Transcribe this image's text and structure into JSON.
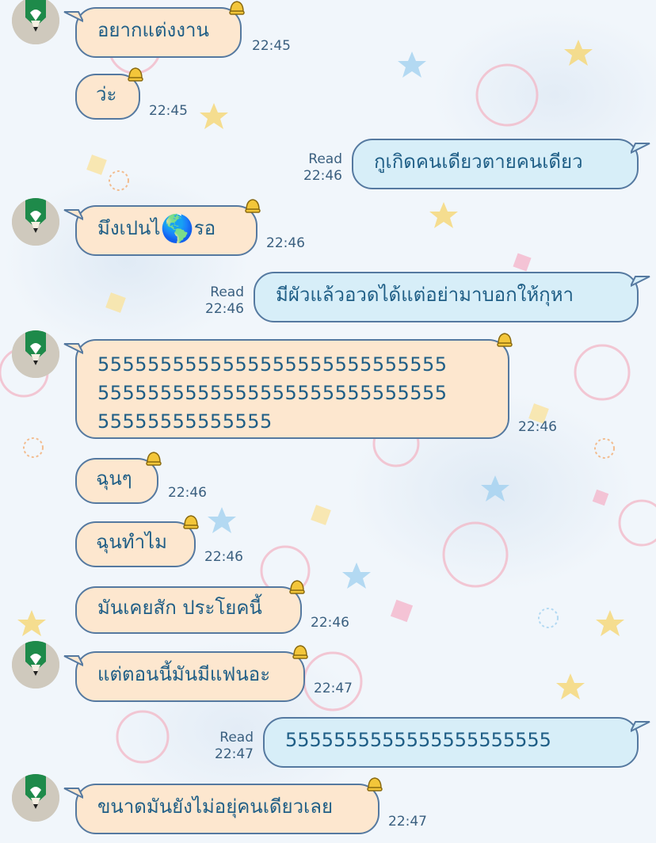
{
  "messages": [
    {
      "id": "m1",
      "side": "in",
      "text": "อยากแต่งงาน",
      "time": "22:45"
    },
    {
      "id": "m2",
      "side": "in",
      "text": "ว่ะ",
      "time": "22:45"
    },
    {
      "id": "m3",
      "side": "out",
      "text": "กูเกิดคนเดียวตายคนเดียว",
      "status": "Read",
      "time": "22:46"
    },
    {
      "id": "m4",
      "side": "in",
      "text_a": "มึงเปนไ",
      "emoji": "🌎",
      "text_b": "รอ",
      "time": "22:46"
    },
    {
      "id": "m5",
      "side": "out",
      "text": "มีผัวแล้วอวดได้แต่อย่ามาบอกให้กุหา",
      "status": "Read",
      "time": "22:46"
    },
    {
      "id": "m6",
      "side": "in",
      "lines": [
        "5555555555555555555555555555",
        "5555555555555555555555555555",
        "55555555555555"
      ],
      "time": "22:46"
    },
    {
      "id": "m7",
      "side": "in",
      "text": "ฉุนๆ",
      "time": "22:46"
    },
    {
      "id": "m8",
      "side": "in",
      "text": "ฉุนทำไม",
      "time": "22:46"
    },
    {
      "id": "m9",
      "side": "in",
      "text": "มันเคยสัก ประโยคนี้",
      "time": "22:46"
    },
    {
      "id": "m10",
      "side": "in",
      "text": "แต่ตอนนี้มันมีแฟนอะ",
      "time": "22:47"
    },
    {
      "id": "m11",
      "side": "out",
      "text": "5555555555555555555555",
      "status": "Read",
      "time": "22:47"
    },
    {
      "id": "m12",
      "side": "in",
      "text": "ขนาดมันยังไม่อยุ่คนเดียวเลย",
      "time": "22:47"
    }
  ],
  "colors": {
    "incoming_bubble": "#fde7cf",
    "outgoing_bubble": "#d7eef8",
    "bubble_border": "#5579a0",
    "text": "#1f5e86",
    "avatar_green": "#1e8a4a"
  },
  "icons": {
    "avatar": "pencil-heart-avatar",
    "bubble_badge": "bell-icon"
  }
}
